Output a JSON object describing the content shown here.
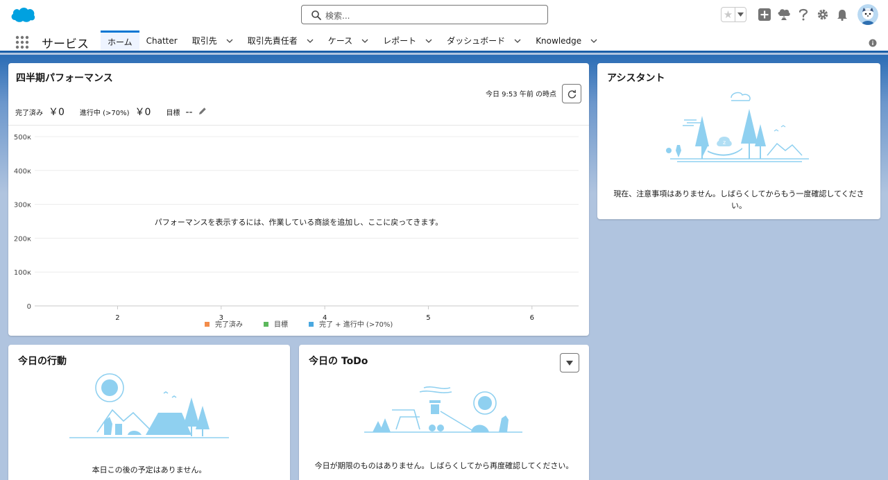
{
  "header": {
    "search_placeholder": "検索..."
  },
  "nav": {
    "app_name": "サービス",
    "tabs": [
      {
        "label": "ホーム",
        "dropdown": false
      },
      {
        "label": "Chatter",
        "dropdown": false
      },
      {
        "label": "取引先",
        "dropdown": true
      },
      {
        "label": "取引先責任者",
        "dropdown": true
      },
      {
        "label": "ケース",
        "dropdown": true
      },
      {
        "label": "レポート",
        "dropdown": true
      },
      {
        "label": "ダッシュボード",
        "dropdown": true
      },
      {
        "label": "Knowledge",
        "dropdown": true
      }
    ]
  },
  "performance": {
    "title": "四半期パフォーマンス",
    "as_of": "今日 9:53 午前 の時点",
    "metrics": [
      {
        "label": "完了済み",
        "value": "￥0"
      },
      {
        "label": "進行中 (>70%)",
        "value": "￥0"
      },
      {
        "label": "目標",
        "value": "--"
      }
    ],
    "empty_message": "パフォーマンスを表示するには、作業している商談を追加し、ここに戻ってきます。"
  },
  "chart_data": {
    "type": "line",
    "x": [
      2,
      3,
      4,
      5,
      6
    ],
    "y_ticks": [
      "500к",
      "400к",
      "300к",
      "200к",
      "100к",
      "0"
    ],
    "ylim": [
      0,
      500000
    ],
    "grid": true,
    "legend_position": "bottom",
    "series": [
      {
        "name": "完了済み",
        "color": "#f38c4a",
        "values": []
      },
      {
        "name": "目標",
        "color": "#5cb85c",
        "values": []
      },
      {
        "name": "完了 + 進行中 (>70%)",
        "color": "#4aa8e0",
        "values": []
      }
    ]
  },
  "assistant": {
    "title": "アシスタント",
    "message": "現在、注意事項はありません。しばらくしてからもう一度確認してください。"
  },
  "events": {
    "title": "今日の行動",
    "message": "本日この後の予定はありません。"
  },
  "todo": {
    "title": "今日の ToDo",
    "message": "今日が期限のものはありません。しばらくしてから再度確認してください。"
  },
  "colors": {
    "brand": "#0176d3",
    "nav_accent": "#1b5fa8",
    "illustration": "#8fd0f0"
  }
}
